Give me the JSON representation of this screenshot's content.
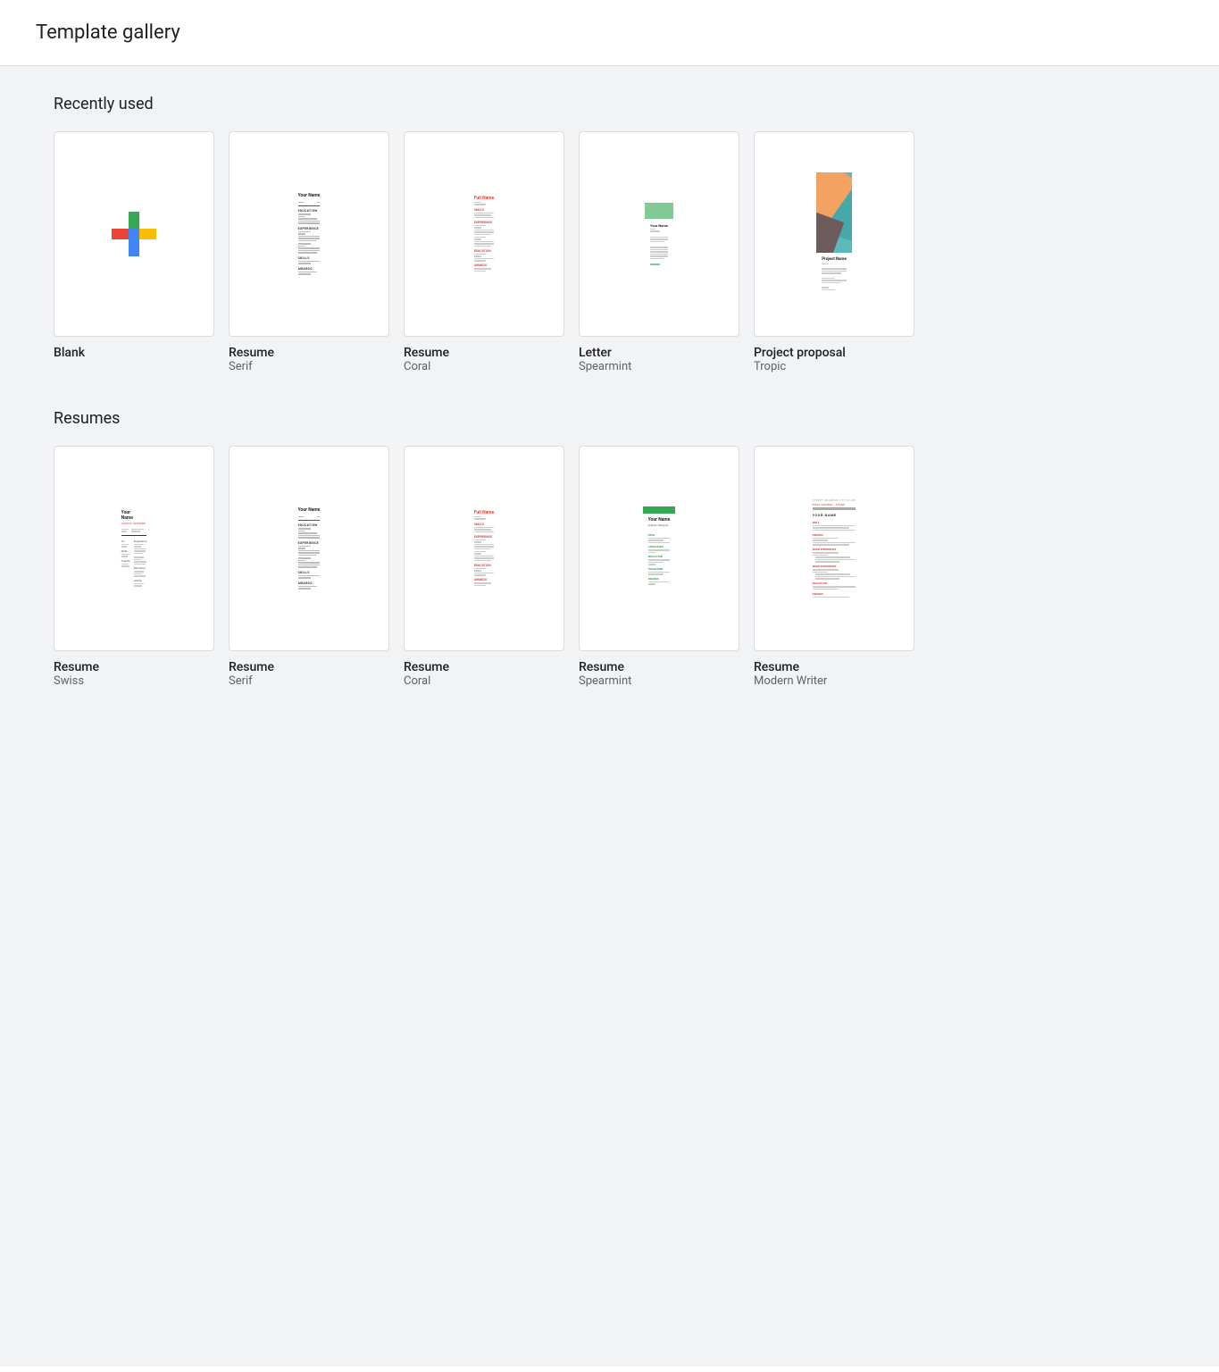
{
  "header": {
    "title": "Template gallery"
  },
  "sections": [
    {
      "id": "recently-used",
      "title": "Recently used",
      "templates": [
        {
          "id": "blank",
          "name": "Blank",
          "subname": "",
          "type": "blank"
        },
        {
          "id": "resume-serif-recent",
          "name": "Resume",
          "subname": "Serif",
          "type": "resume-serif"
        },
        {
          "id": "resume-coral-recent",
          "name": "Resume",
          "subname": "Coral",
          "type": "resume-coral"
        },
        {
          "id": "letter-spearmint",
          "name": "Letter",
          "subname": "Spearmint",
          "type": "letter-spearmint"
        },
        {
          "id": "project-proposal-tropic",
          "name": "Project proposal",
          "subname": "Tropic",
          "type": "project-proposal-tropic"
        }
      ]
    },
    {
      "id": "resumes",
      "title": "Resumes",
      "templates": [
        {
          "id": "resume-swiss",
          "name": "Resume",
          "subname": "Swiss",
          "type": "resume-swiss"
        },
        {
          "id": "resume-serif",
          "name": "Resume",
          "subname": "Serif",
          "type": "resume-serif"
        },
        {
          "id": "resume-coral",
          "name": "Resume",
          "subname": "Coral",
          "type": "resume-coral"
        },
        {
          "id": "resume-spearmint",
          "name": "Resume",
          "subname": "Spearmint",
          "type": "resume-spearmint"
        },
        {
          "id": "resume-modern",
          "name": "Resume",
          "subname": "Modern Writer",
          "type": "resume-modern"
        }
      ]
    }
  ]
}
